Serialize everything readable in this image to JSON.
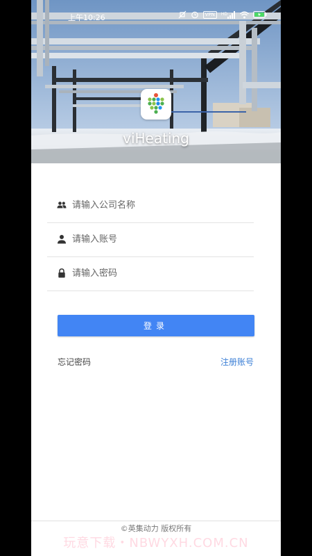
{
  "status_bar": {
    "time": "上午10:26",
    "vpn_badge": "VPN",
    "network_badge": "HD"
  },
  "app": {
    "name": "viHeating"
  },
  "form": {
    "company_placeholder": "请输入公司名称",
    "account_placeholder": "请输入账号",
    "password_placeholder": "请输入密码",
    "login_label": "登录",
    "forgot_label": "忘记密码",
    "register_label": "注册账号"
  },
  "footer": {
    "copyright": "©英集动力 版权所有"
  },
  "watermark": "玩意下载・NBWYXH.COM.CN",
  "colors": {
    "primary": "#4285f4",
    "link": "#3b7fd6"
  },
  "icons": {
    "company": "group-icon",
    "account": "person-icon",
    "password": "lock-icon"
  }
}
